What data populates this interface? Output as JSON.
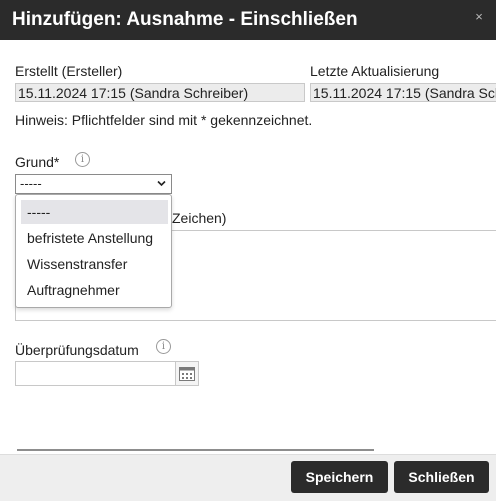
{
  "dialog": {
    "title": "Hinzufügen: Ausnahme - Einschließen",
    "close_glyph": "×"
  },
  "fields": {
    "created_label": "Erstellt (Ersteller)",
    "created_value": "15.11.2024 17:15 (Sandra Schreiber)",
    "updated_label": "Letzte Aktualisierung",
    "updated_value": "15.11.2024 17:15 (Sandra Schreiber)",
    "hint": "Hinweis: Pflichtfelder sind mit * gekennzeichnet.",
    "reason_label": "Grund*",
    "reason_selected": "-----",
    "comment_label_partial": "Zeichen)",
    "review_date_label": "Überprüfungsdatum",
    "review_date_value": ""
  },
  "dropdown": {
    "options": [
      "-----",
      "befristete Anstellung",
      "Wissenstransfer",
      "Auftragnehmer"
    ],
    "selected_index": 0
  },
  "icons": {
    "info": "info-icon",
    "chevron": "chevron-down-icon",
    "calendar": "calendar-icon",
    "close": "close-icon"
  },
  "footer": {
    "save_label": "Speichern",
    "close_label": "Schließen"
  },
  "colors": {
    "titlebar": "#2b2b2b",
    "button": "#2b2b2b",
    "footer": "#eeeeee",
    "selected_option": "#e4e4e8"
  }
}
